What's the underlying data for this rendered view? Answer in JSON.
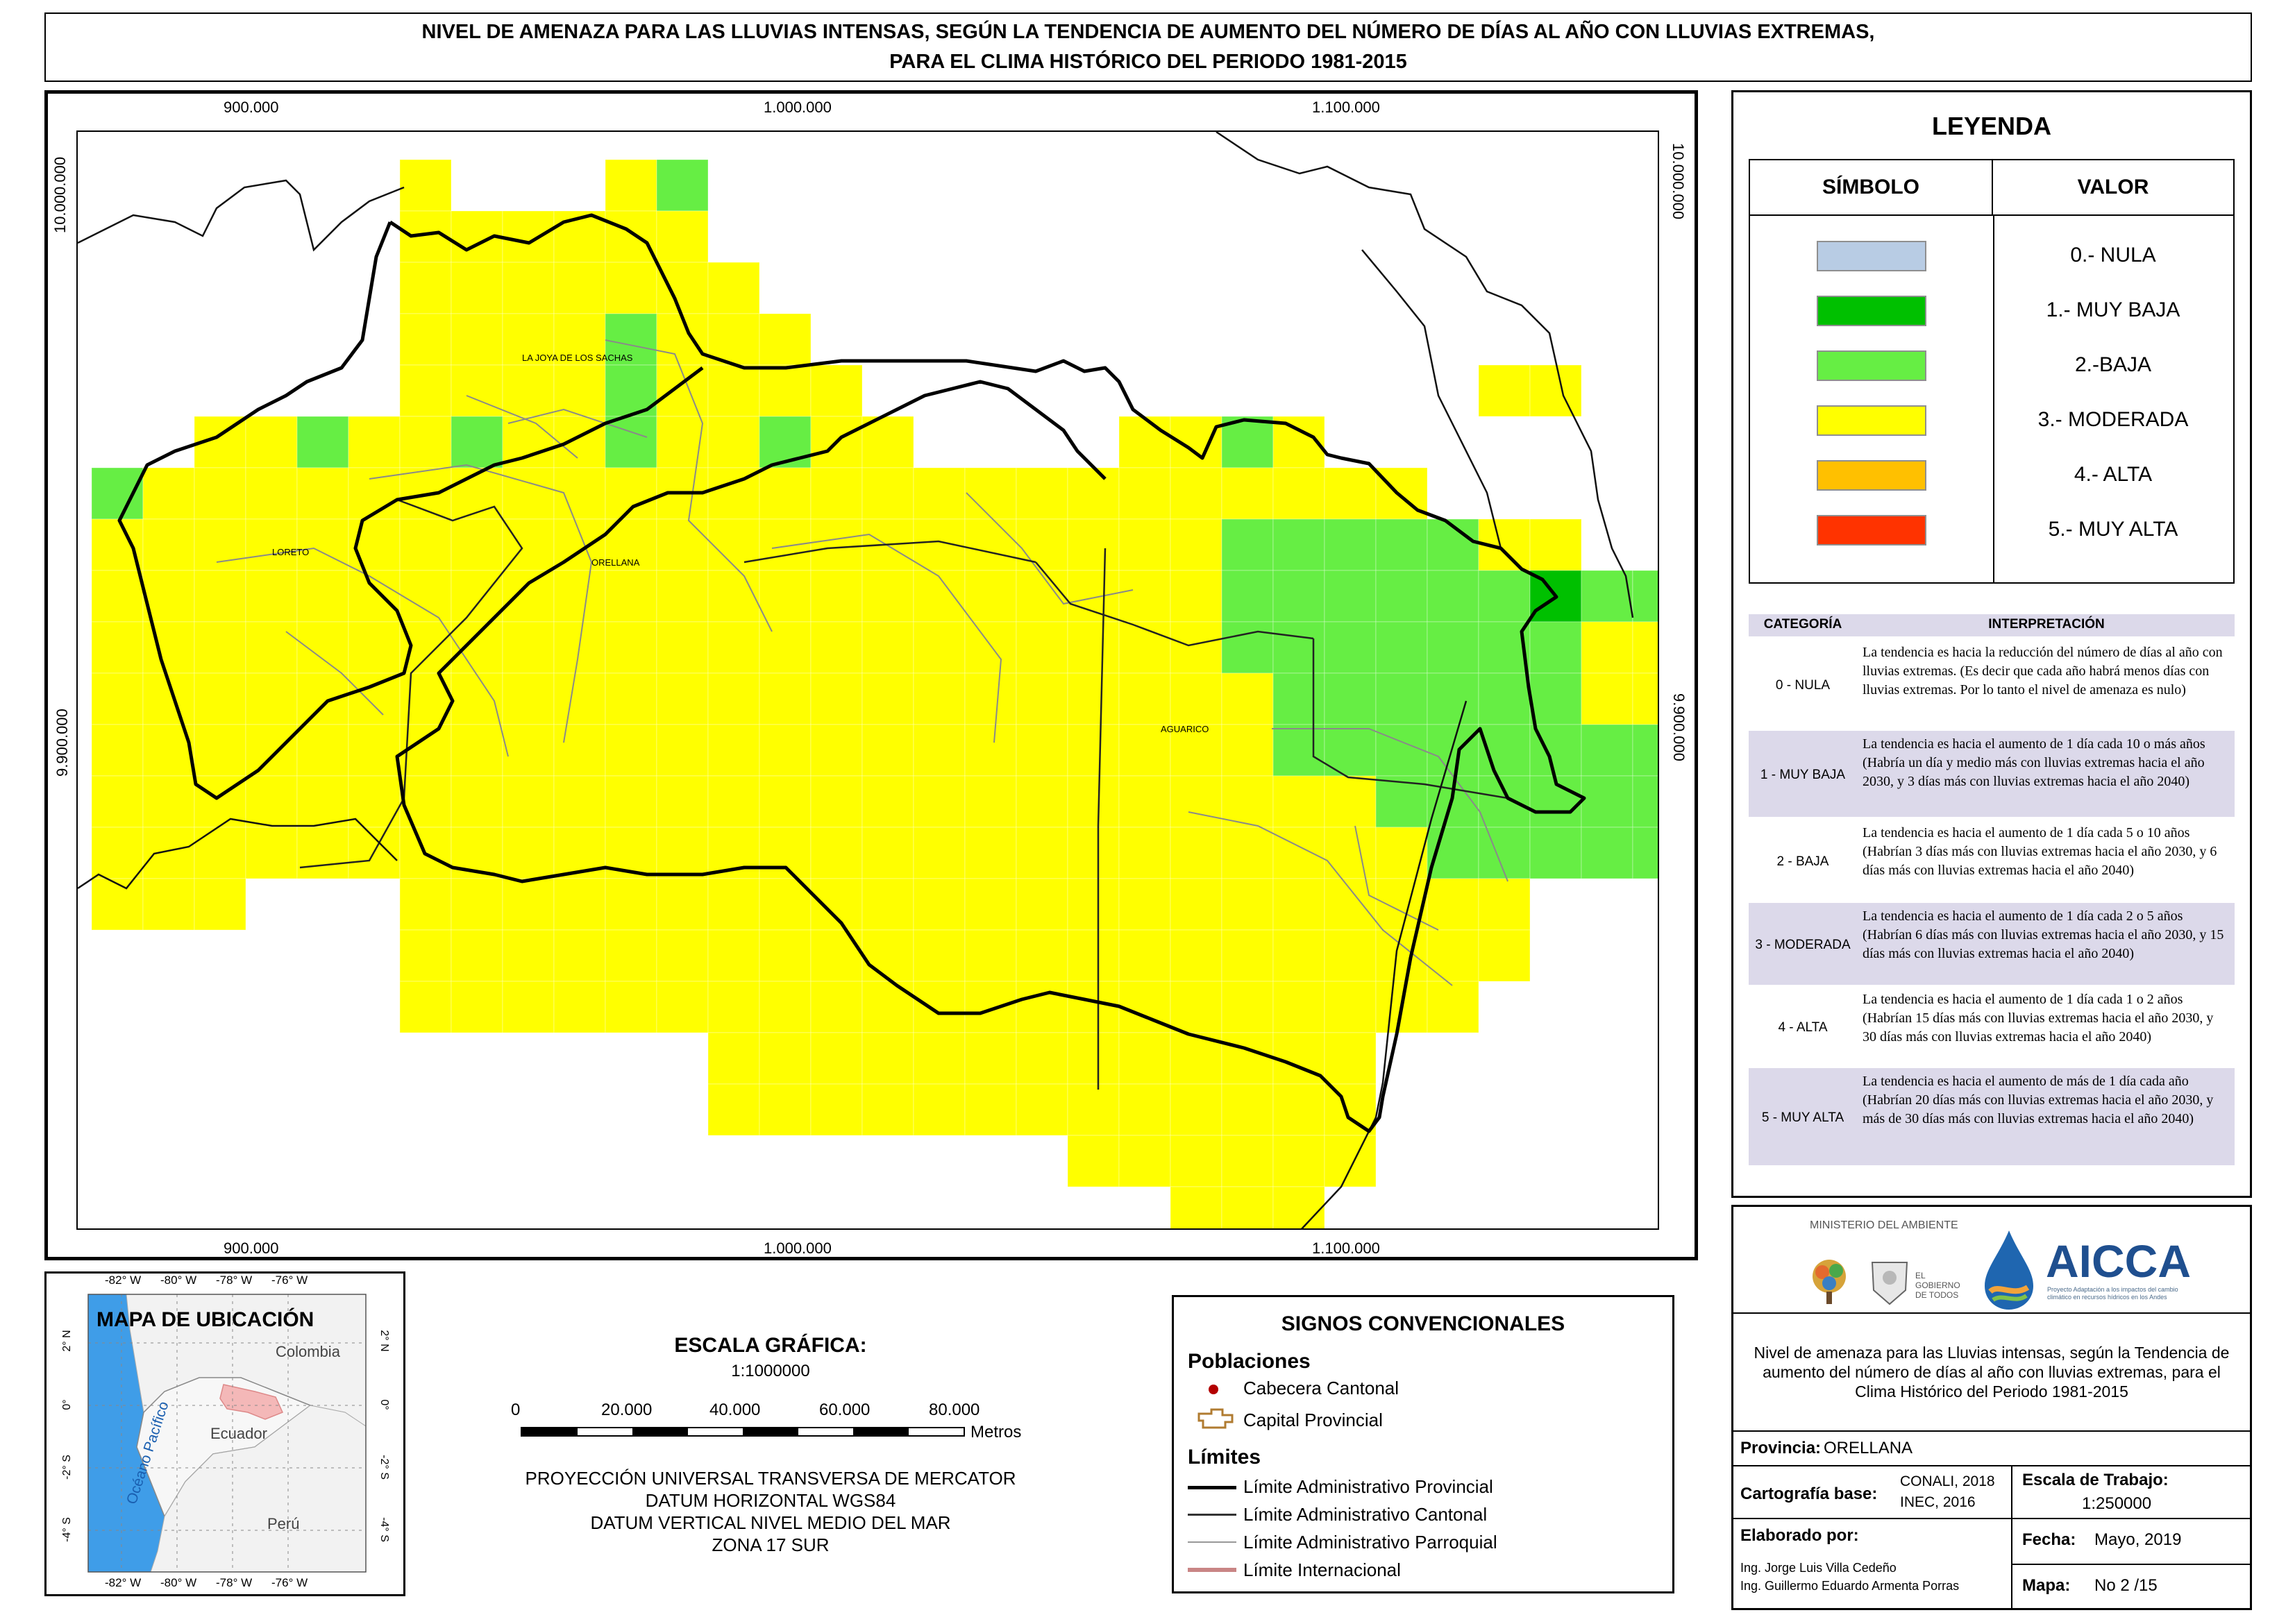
{
  "title": {
    "line1": "NIVEL DE AMENAZA PARA LAS LLUVIAS INTENSAS, SEGÚN LA TENDENCIA DE AUMENTO DEL NÚMERO DE DÍAS AL AÑO CON LLUVIAS EXTREMAS,",
    "line2": "PARA EL CLIMA HISTÓRICO DEL PERIODO 1981-2015"
  },
  "map": {
    "x_ticks": [
      "900.000",
      "1.000.000",
      "1.100.000"
    ],
    "y_ticks": [
      "10.000.000",
      "9.900.000"
    ],
    "cantons": [
      "LA JOYA DE LOS SACHAS",
      "LORETO",
      "ORELLANA",
      "AGUARICO"
    ],
    "colors": {
      "nula": "#b8cce4",
      "muy_baja": "#00c000",
      "baja": "#66ee44",
      "moderada": "#ffff00",
      "alta": "#ffc000",
      "muy_alta": "#ff3300"
    }
  },
  "legend": {
    "title": "LEYENDA",
    "col_symbol": "SÍMBOLO",
    "col_value": "VALOR",
    "items": [
      {
        "label": "0.- NULA",
        "color": "#b8cce4"
      },
      {
        "label": "1.- MUY BAJA",
        "color": "#00c000"
      },
      {
        "label": "2.-BAJA",
        "color": "#66ee44"
      },
      {
        "label": "3.- MODERADA",
        "color": "#ffff00"
      },
      {
        "label": "4.- ALTA",
        "color": "#ffc000"
      },
      {
        "label": "5.- MUY ALTA",
        "color": "#ff3300"
      }
    ],
    "interp_header": {
      "category": "CATEGORÍA",
      "interpretation": "INTERPRETACIÓN"
    },
    "interp": [
      {
        "cat": "0 - NULA",
        "text": "La tendencia es hacia la reducción del número de días al año con lluvias extremas. (Es decir que cada año habrá menos días con lluvias extremas. Por lo tanto el nivel de amenaza es nulo)"
      },
      {
        "cat": "1 - MUY BAJA",
        "text": "La tendencia es hacia el aumento de 1 día cada 10 o más años (Habría un día y medio más con lluvias extremas hacia el año 2030, y 3 días más con lluvias extremas hacia el año 2040)"
      },
      {
        "cat": "2 - BAJA",
        "text": "La tendencia es hacia el aumento de 1 día cada 5 o 10 años (Habrían 3 días más con lluvias extremas hacia el año 2030, y 6 días más con lluvias extremas hacia el año 2040)"
      },
      {
        "cat": "3 - MODERADA",
        "text": "La tendencia es hacia el aumento de 1 día cada 2 o 5 años (Habrían 6 días más con lluvias extremas hacia el año 2030, y 15 días más con lluvias extremas hacia el año 2040)"
      },
      {
        "cat": "4 - ALTA",
        "text": "La tendencia es hacia el aumento de 1 día cada 1 o 2 años (Habrían 15 días más con lluvias extremas hacia el año 2030, y 30 días más con lluvias extremas hacia el año 2040)"
      },
      {
        "cat": "5 - MUY ALTA",
        "text": "La tendencia es hacia el aumento de más de 1 día cada año (Habrían 20 días más con lluvias extremas hacia el año 2030, y más de 30 días más con lluvias extremas hacia el año 2040)"
      }
    ]
  },
  "location_map": {
    "title": "MAPA DE UBICACIÓN",
    "lon_ticks": [
      "-82° W",
      "-80° W",
      "-78° W",
      "-76° W"
    ],
    "lat_ticks": [
      "2° N",
      "0°",
      "-2° S",
      "-4° S"
    ],
    "countries": [
      "Colombia",
      "Ecuador",
      "Perú"
    ],
    "ocean": "Océano Pacífico"
  },
  "scale": {
    "title": "ESCALA GRÁFICA:",
    "ratio": "1:1000000",
    "ticks": [
      "0",
      "20.000",
      "40.000",
      "60.000",
      "80.000"
    ],
    "unit": "Metros",
    "projection": [
      "PROYECCIÓN UNIVERSAL TRANSVERSA DE MERCATOR",
      "DATUM HORIZONTAL WGS84",
      "DATUM VERTICAL NIVEL MEDIO DEL MAR",
      "ZONA 17 SUR"
    ]
  },
  "signos": {
    "title": "SIGNOS CONVENCIONALES",
    "poblaciones": "Poblaciones",
    "cabecera": "Cabecera Cantonal",
    "capital": "Capital Provincial",
    "limites": "Límites",
    "lim_prov": "Límite Administrativo Provincial",
    "lim_cant": "Límite Administrativo Cantonal",
    "lim_parr": "Límite Administrativo Parroquial",
    "lim_int": "Límite Internacional"
  },
  "info": {
    "ministry": "MINISTERIO DEL AMBIENTE",
    "gov": "EL GOBIERNO DE TODOS",
    "aicca": "AICCA",
    "aicca_sub": "Proyecto Adaptación a los impactos del cambio climático en recursos hídricos en los Andes",
    "description": "Nivel de amenaza para las Lluvias intensas, según la Tendencia de aumento del número de días al año con lluvias extremas, para el Clima Histórico del Periodo 1981-2015",
    "provincia_label": "Provincia:",
    "provincia": "ORELLANA",
    "cart_label": "Cartografía base:",
    "cart_1": "CONALI, 2018",
    "cart_2": "INEC, 2016",
    "escala_label": "Escala de Trabajo:",
    "escala": "1:250000",
    "elab_label": "Elaborado por:",
    "elab_1": "Ing. Jorge Luis Villa Cedeño",
    "elab_2": "Ing. Guillermo Eduardo Armenta Porras",
    "fecha_label": "Fecha:",
    "fecha": "Mayo, 2019",
    "mapa_label": "Mapa:",
    "mapa": "No 2 /15"
  }
}
